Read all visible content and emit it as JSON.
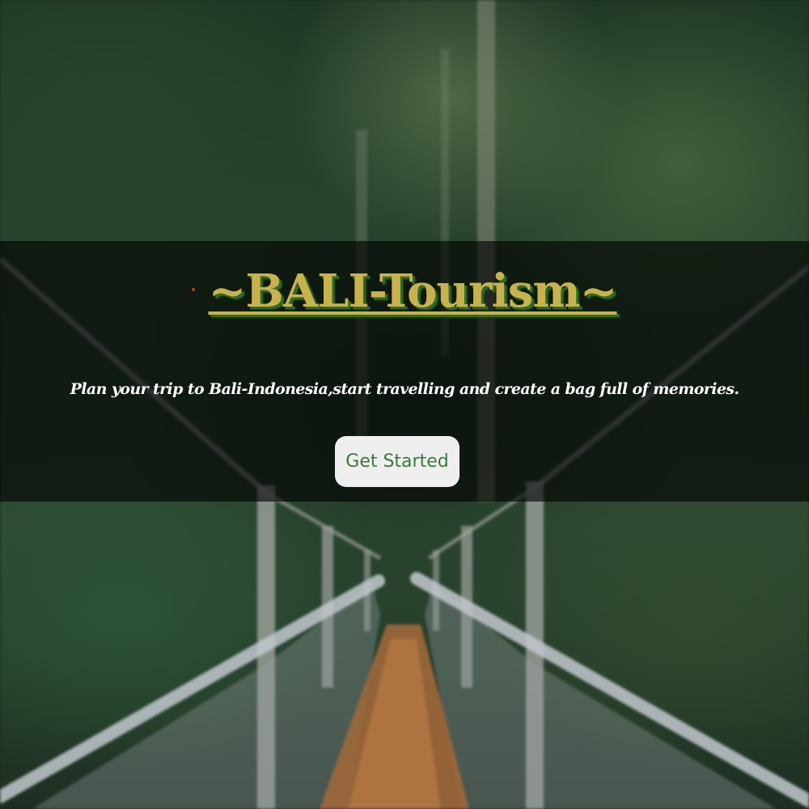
{
  "page": {
    "background": "forest suspension bridge photo"
  },
  "hero": {
    "title": "~BALI-Tourism~",
    "tagline": "Plan your trip to Bali-Indonesia,start travelling and create a bag full of memories.",
    "cta_label": "Get Started"
  },
  "colors": {
    "title": "#c9b24d",
    "title_shadow": "#2e6b2a",
    "cta_text": "#3a7a3a",
    "cta_background": "#efefef",
    "band": "rgba(0,0,0,0.62)"
  }
}
